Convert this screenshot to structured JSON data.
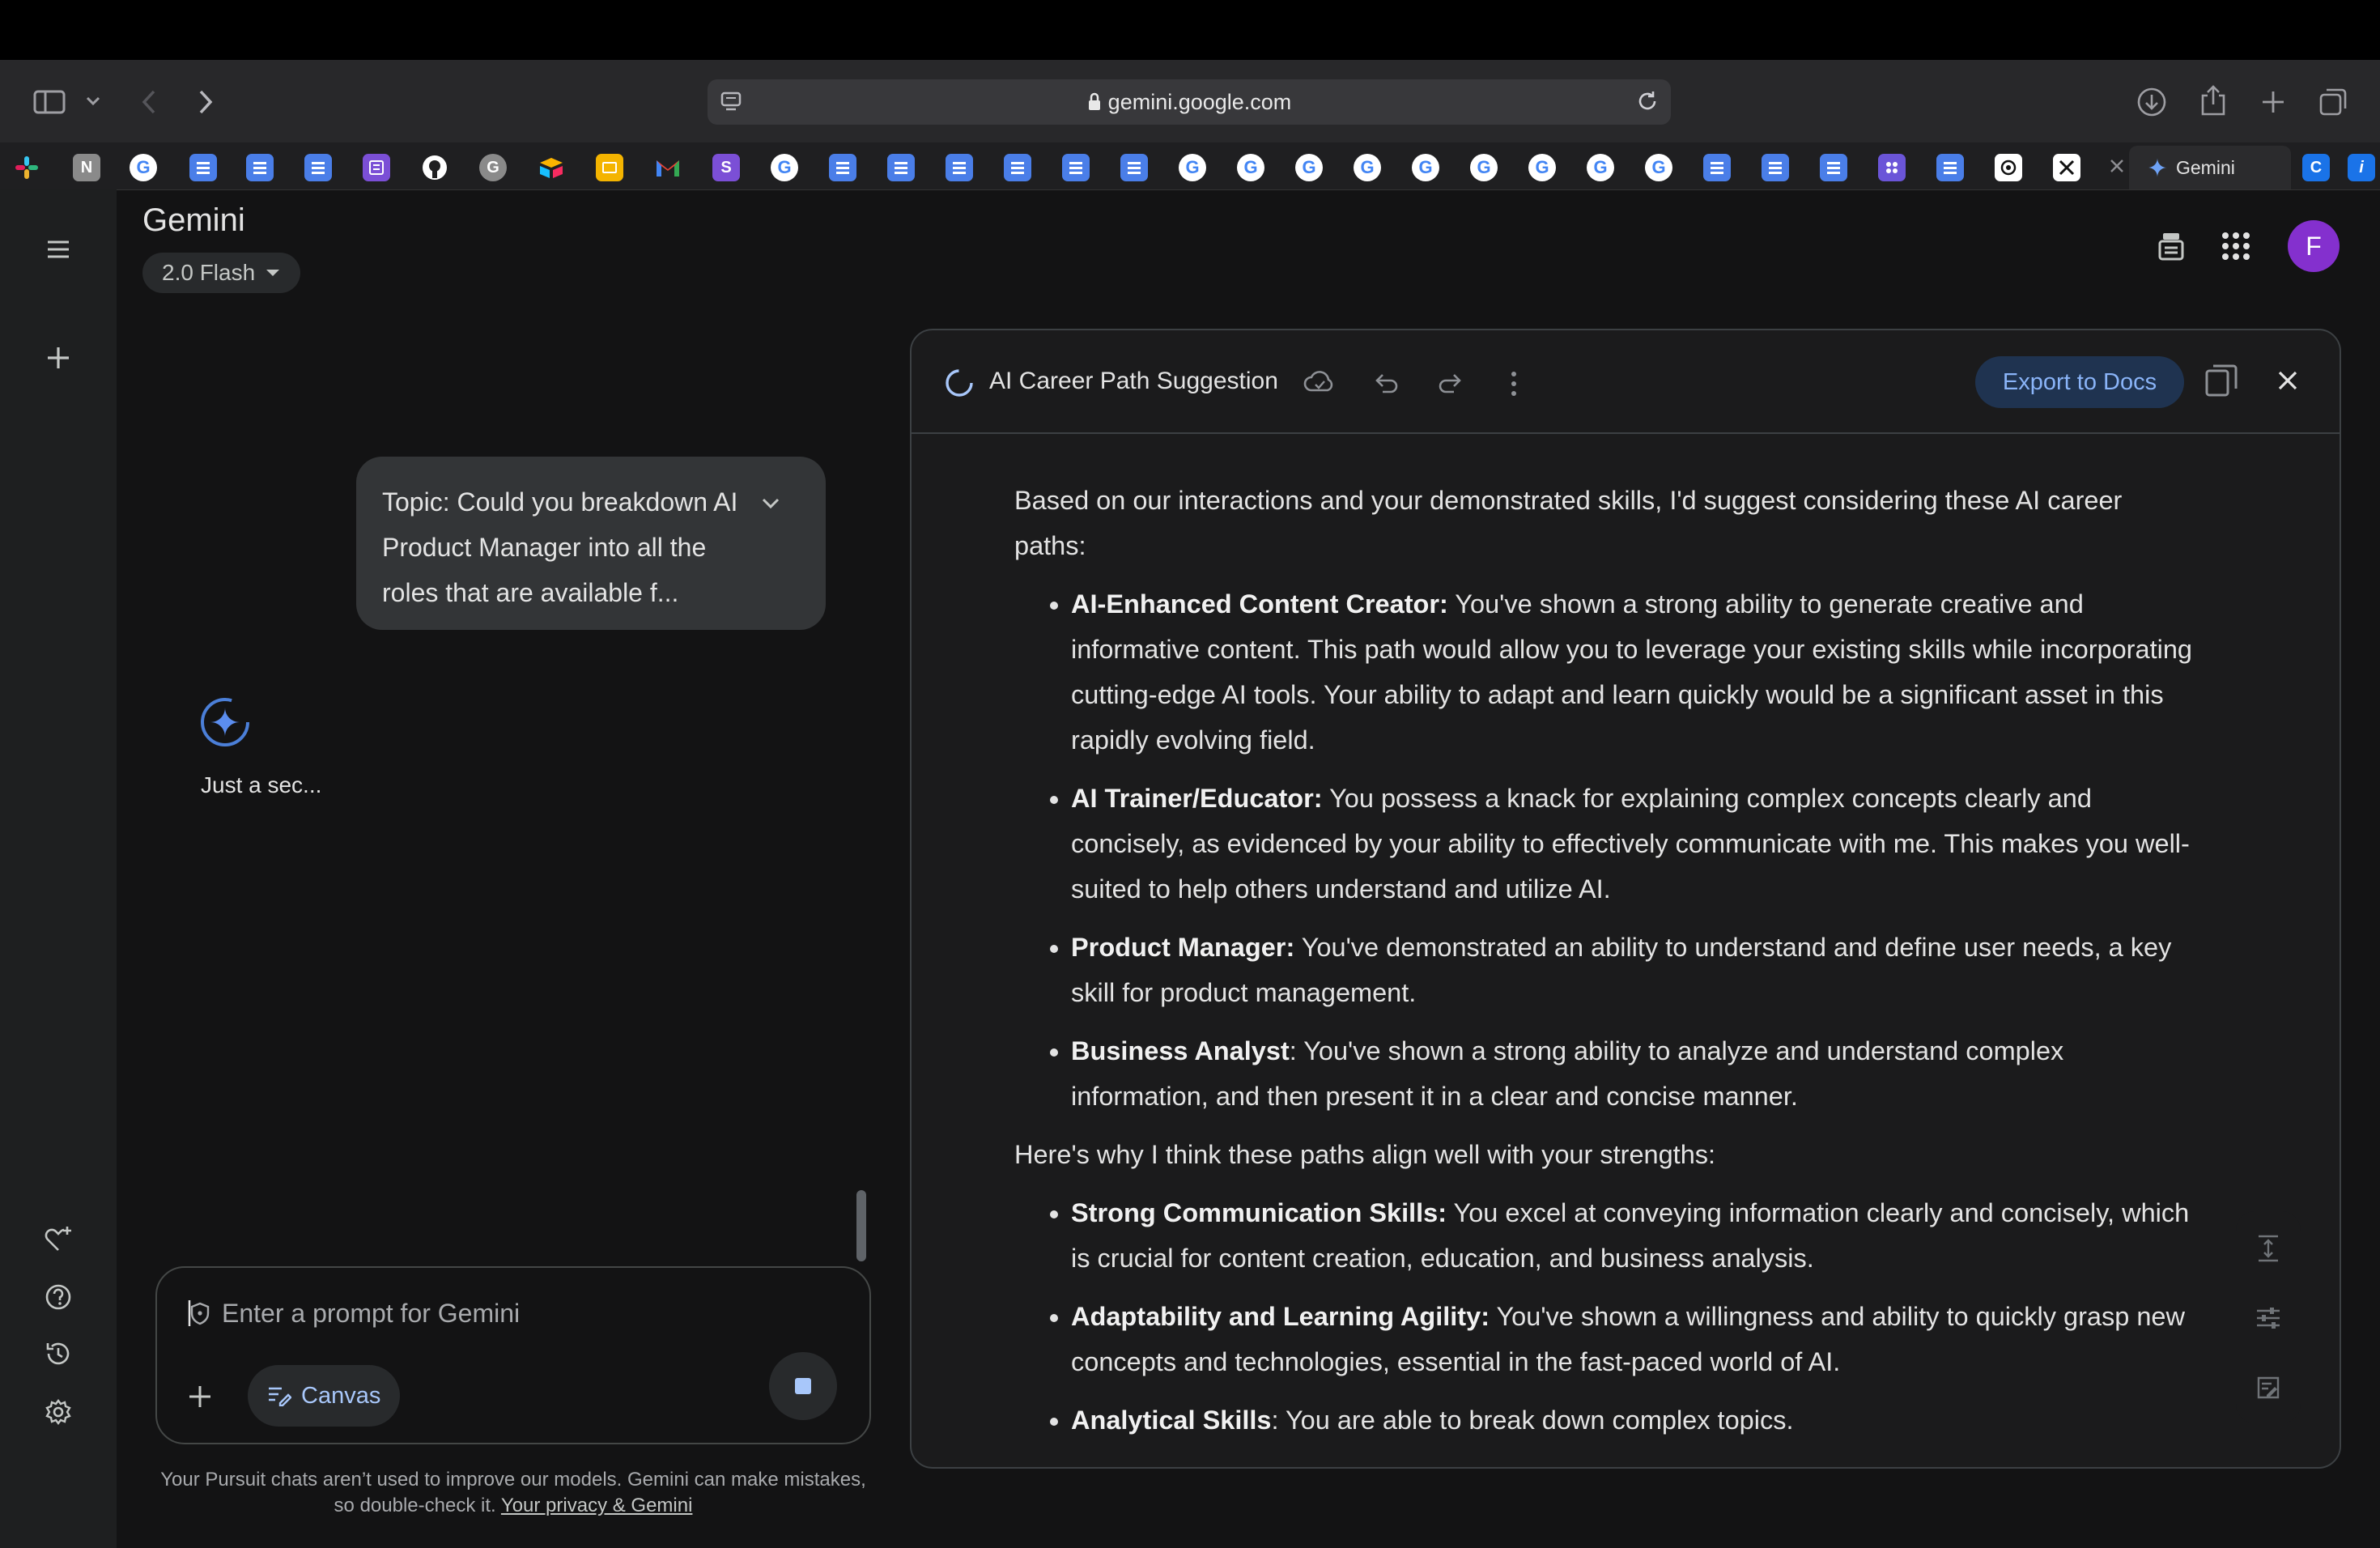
{
  "browser": {
    "url": "gemini.google.com",
    "active_tab_title": "Gemini",
    "favicon_letters": {
      "notion": "N",
      "grammarly": "G",
      "stripe": "S"
    }
  },
  "app": {
    "title": "Gemini",
    "model": "2.0 Flash",
    "avatar_letter": "F",
    "accent_color": "#a142f4"
  },
  "chat": {
    "user_message": "Topic: Could you breakdown AI Product Manager into all the roles that are available f...",
    "status": "Just a sec...",
    "prompt_placeholder": "Enter a prompt for Gemini",
    "canvas_label": "Canvas",
    "footer_text": "Your Pursuit chats aren’t used to improve our models. Gemini can make mistakes, so double-check it.",
    "footer_link": "Your privacy & Gemini"
  },
  "canvas": {
    "doc_title": "AI Career Path Suggestion",
    "export_label": "Export to Docs",
    "intro": "Based on our interactions and your demonstrated skills, I'd suggest considering these AI career paths:",
    "paths": [
      {
        "title": "AI-Enhanced Content Creator:",
        "text": " You've shown a strong ability to generate creative and informative content. This path would allow you to leverage your existing skills while incorporating cutting-edge AI tools. Your ability to adapt and learn quickly would be a significant asset in this rapidly evolving field."
      },
      {
        "title": "AI Trainer/Educator:",
        "text": " You possess a knack for explaining complex concepts clearly and concisely, as evidenced by your ability to effectively communicate with me. This makes you well-suited to help others understand and utilize AI."
      },
      {
        "title": "Product Manager:",
        "text": " You've demonstrated an ability to understand and define user needs, a key skill for product management."
      },
      {
        "title": "Business Analyst",
        "text": ": You've shown a strong ability to analyze and understand complex information, and then present it in a clear and concise manner."
      }
    ],
    "why_heading": "Here's why I think these paths align well with your strengths:",
    "strengths": [
      {
        "title": "Strong Communication Skills:",
        "text": " You excel at conveying information clearly and concisely, which is crucial for content creation, education, and business analysis."
      },
      {
        "title": "Adaptability and Learning Agility:",
        "text": " You've shown a willingness and ability to quickly grasp new concepts and technologies, essential in the fast-paced world of AI."
      },
      {
        "title": "Analytical Skills",
        "text": ": You are able to break down complex topics."
      }
    ]
  }
}
